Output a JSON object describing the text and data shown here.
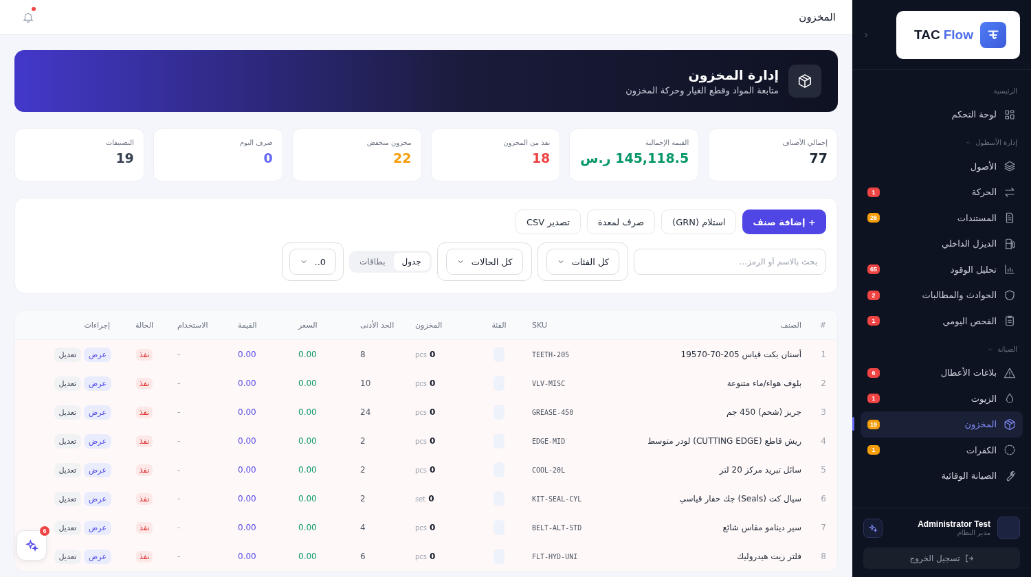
{
  "topbar": {
    "title": "المخزون",
    "notification": true
  },
  "banner": {
    "title": "إدارة المخزون",
    "subtitle": "متابعة المواد وقطع الغيار وحركة المخزون"
  },
  "stats": [
    {
      "label": "إجمالي الأصناف",
      "value": "77",
      "color": "#1f2937"
    },
    {
      "label": "القيمة الإجمالية",
      "value": "145,118.5 ر.س",
      "color": "#059669"
    },
    {
      "label": "نفذ من المخزون",
      "value": "18",
      "color": "#ef4444"
    },
    {
      "label": "مخزون منخفض",
      "value": "22",
      "color": "#f59e0b"
    },
    {
      "label": "صرف اليوم",
      "value": "0",
      "color": "#6366f1"
    },
    {
      "label": "التصنيفات",
      "value": "19",
      "color": "#374151"
    }
  ],
  "actions": [
    {
      "label": "+ إضافة صنف",
      "kind": "primary"
    },
    {
      "label": "استلام (GRN)",
      "kind": "secondary"
    },
    {
      "label": "صرف لمعدة",
      "kind": "secondary"
    },
    {
      "label": "تصدير CSV",
      "kind": "secondary"
    }
  ],
  "filters": {
    "search": {
      "placeholder": "بحث بالاسم أو الرمز..."
    },
    "category": "كل الفئات",
    "status": "كل الحالات",
    "view": [
      {
        "label": "جدول",
        "selected": true
      },
      {
        "label": "بطاقات",
        "selected": false
      }
    ],
    "page_size": "0.."
  },
  "table": {
    "columns": [
      "#",
      "الصنف",
      "SKU",
      "الفئة",
      "المخزون",
      "الحد الأدنى",
      "السعر",
      "القيمة",
      "الاستخدام",
      "الحالة",
      "إجراءات"
    ],
    "rows": [
      {
        "num": "1",
        "name": "أسنان بكت قياس 205-70-19570",
        "sku": "TEETH-205",
        "stock": "0",
        "unit": "pcs",
        "min": "8",
        "price": "0.00",
        "value": "0.00",
        "usage": "-",
        "status": "نفذ",
        "actions": [
          "عرض",
          "تعديل"
        ]
      },
      {
        "num": "2",
        "name": "بلوف هواء/ماء متنوعة",
        "sku": "VLV-MISC",
        "stock": "0",
        "unit": "pcs",
        "min": "10",
        "price": "0.00",
        "value": "0.00",
        "usage": "-",
        "status": "نفذ",
        "actions": [
          "عرض",
          "تعديل"
        ]
      },
      {
        "num": "3",
        "name": "جريز (شحم) 450 جم",
        "sku": "GREASE-450",
        "stock": "0",
        "unit": "pcs",
        "min": "24",
        "price": "0.00",
        "value": "0.00",
        "usage": "-",
        "status": "نفذ",
        "actions": [
          "عرض",
          "تعديل"
        ]
      },
      {
        "num": "4",
        "name": "ريش قاطع (CUTTING EDGE) لودر متوسط",
        "sku": "EDGE-MID",
        "stock": "0",
        "unit": "pcs",
        "min": "2",
        "price": "0.00",
        "value": "0.00",
        "usage": "-",
        "status": "نفذ",
        "actions": [
          "عرض",
          "تعديل"
        ]
      },
      {
        "num": "5",
        "name": "سائل تبريد مركز 20 لتر",
        "sku": "COOL-20L",
        "stock": "0",
        "unit": "pcs",
        "min": "2",
        "price": "0.00",
        "value": "0.00",
        "usage": "-",
        "status": "نفذ",
        "actions": [
          "عرض",
          "تعديل"
        ]
      },
      {
        "num": "6",
        "name": "سيال كت (Seals) جك حفار قياسي",
        "sku": "KIT-SEAL-CYL",
        "stock": "0",
        "unit": "set",
        "min": "2",
        "price": "0.00",
        "value": "0.00",
        "usage": "-",
        "status": "نفذ",
        "actions": [
          "عرض",
          "تعديل"
        ]
      },
      {
        "num": "7",
        "name": "سير دينامو مقاس شائع",
        "sku": "BELT-ALT-STD",
        "stock": "0",
        "unit": "pcs",
        "min": "4",
        "price": "0.00",
        "value": "0.00",
        "usage": "-",
        "status": "نفذ",
        "actions": [
          "عرض",
          "تعديل"
        ]
      },
      {
        "num": "8",
        "name": "فلتر زيت هيدروليك",
        "sku": "FLT-HYD-UNI",
        "stock": "0",
        "unit": "pcs",
        "min": "6",
        "price": "0.00",
        "value": "0.00",
        "usage": "-",
        "status": "نفذ",
        "actions": [
          "عرض",
          "تعديل"
        ]
      }
    ]
  },
  "assistant": {
    "badge": "6"
  },
  "sidebar": {
    "logo": {
      "word1": "TAC",
      "word2": "Flow"
    },
    "sections": [
      {
        "label": "الرئيسية",
        "items": [
          {
            "label": "لوحة التحكم",
            "selected": false
          }
        ]
      },
      {
        "label": "إدارة الأسطول",
        "expanded": true,
        "items": [
          {
            "label": "الأصول",
            "selected": false
          },
          {
            "label": "الحركة",
            "badge": "1",
            "color": "#ef4444",
            "selected": false
          },
          {
            "label": "المستندات",
            "badge": "26",
            "color": "#f59e0b",
            "selected": false
          },
          {
            "label": "الديزل الداخلي",
            "selected": false
          },
          {
            "label": "تحليل الوقود",
            "badge": "65",
            "color": "#ef4444",
            "selected": false
          },
          {
            "label": "الحوادث والمطالبات",
            "badge": "2",
            "color": "#ef4444",
            "selected": false
          },
          {
            "label": "الفحص اليومي",
            "badge": "1",
            "color": "#ef4444",
            "selected": false
          }
        ]
      },
      {
        "label": "الصيانة",
        "expanded": true,
        "items": [
          {
            "label": "بلاغات الأعطال",
            "badge": "6",
            "color": "#ef4444",
            "selected": false
          },
          {
            "label": "الزيوت",
            "badge": "1",
            "color": "#ef4444",
            "selected": false
          },
          {
            "label": "المخزون",
            "badge": "19",
            "color": "#f59e0b",
            "selected": true
          },
          {
            "label": "الكفرات",
            "badge": "1",
            "color": "#f59e0b",
            "selected": false
          },
          {
            "label": "الصيانة الوقائية",
            "selected": false
          }
        ]
      }
    ],
    "user": {
      "name": "Administrator Test",
      "role": "مدير النظام"
    },
    "logout": "تسجيل الخروج"
  }
}
